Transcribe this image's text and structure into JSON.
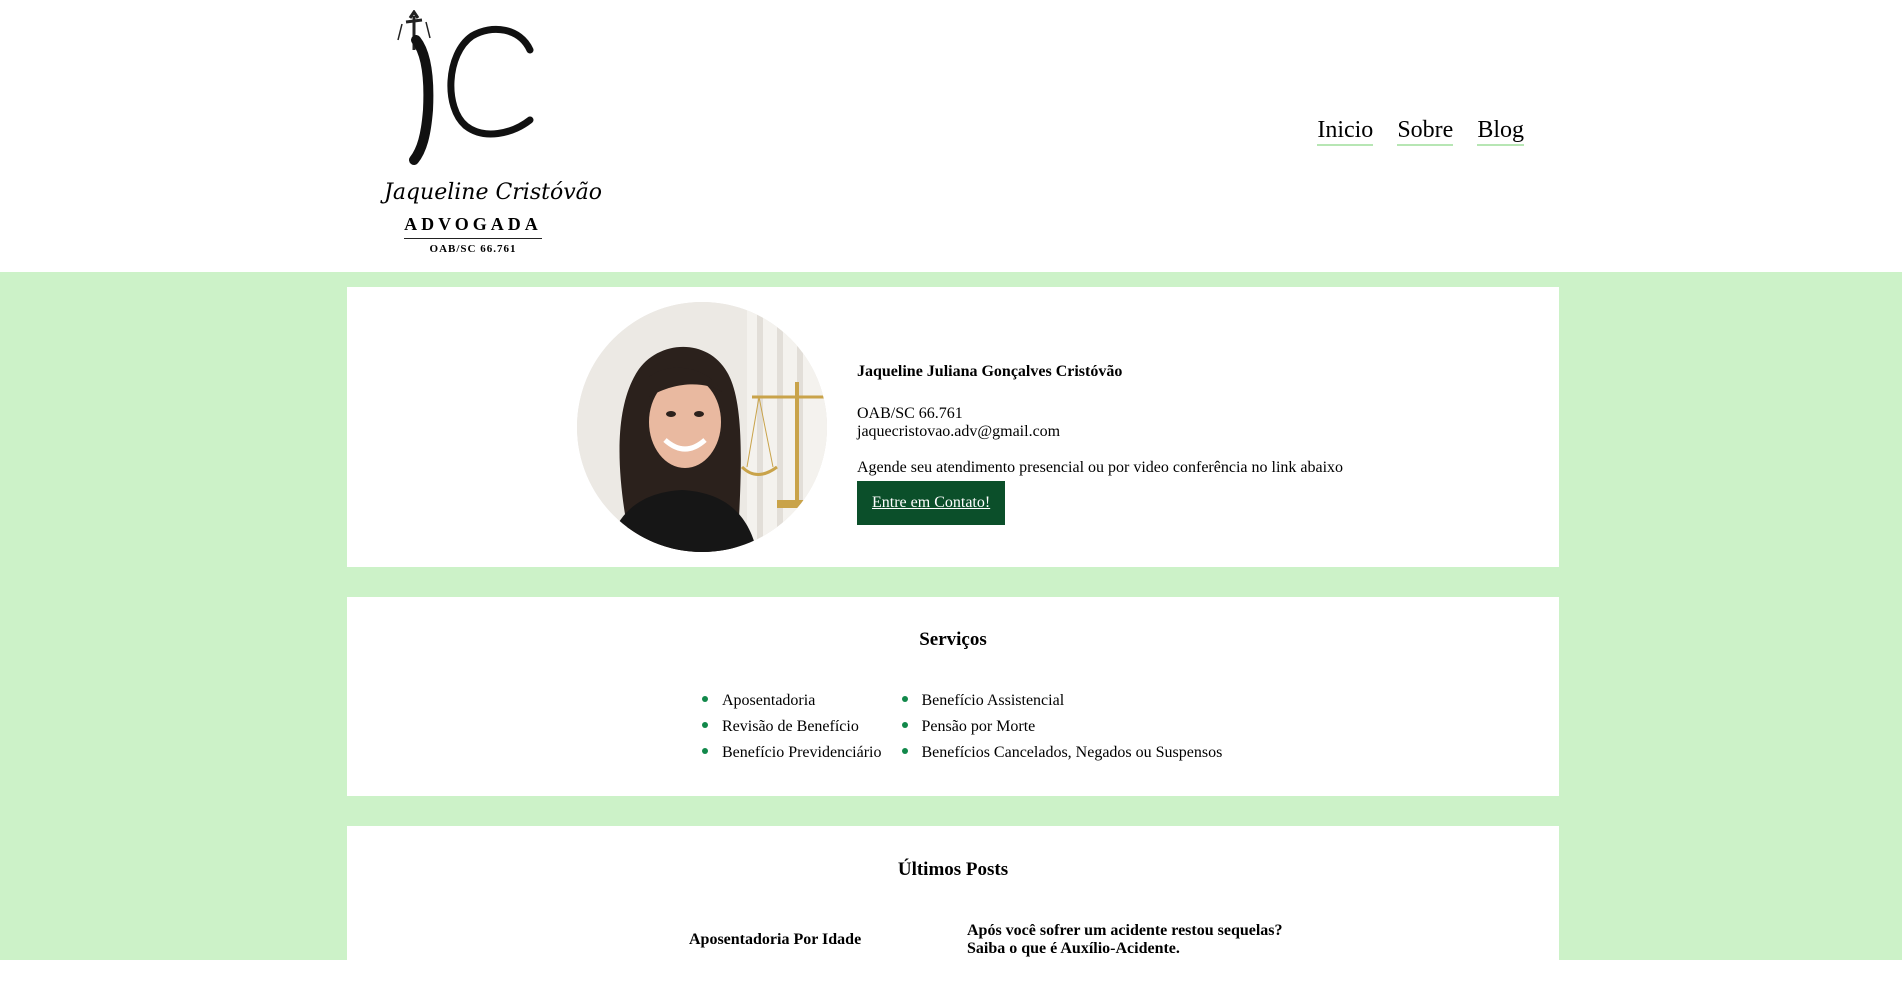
{
  "logo": {
    "script_name": "Jaqueline Cristóvão",
    "role": "ADVOGADA",
    "oab": "OAB/SC 66.761"
  },
  "nav": {
    "items": [
      {
        "label": "Inicio"
      },
      {
        "label": "Sobre"
      },
      {
        "label": "Blog"
      }
    ]
  },
  "profile": {
    "name": "Jaqueline Juliana Gonçalves Cristóvão",
    "oab": "OAB/SC 66.761",
    "email": "jaquecristovao.adv@gmail.com",
    "cta_text": "Agende seu atendimento presencial ou por video conferência no link abaixo",
    "button_label": "Entre em Contato!"
  },
  "services": {
    "title": "Serviços",
    "column_1": [
      "Aposentadoria",
      "Revisão de Benefício",
      "Benefício Previdenciário"
    ],
    "column_2": [
      "Benefício Assistencial",
      "Pensão por Morte",
      "Benefícios Cancelados, Negados ou Suspensos"
    ]
  },
  "posts": {
    "title": "Últimos Posts",
    "items": [
      {
        "title": "Aposentadoria Por Idade"
      },
      {
        "title_line_1": "Após você sofrer um acidente restou sequelas?",
        "title_line_2": "Saiba o que é Auxílio-Acidente."
      }
    ]
  },
  "colors": {
    "background_green": "#ccf2c8",
    "button_green": "#0b4f2a",
    "bullet_green": "#11884a"
  }
}
